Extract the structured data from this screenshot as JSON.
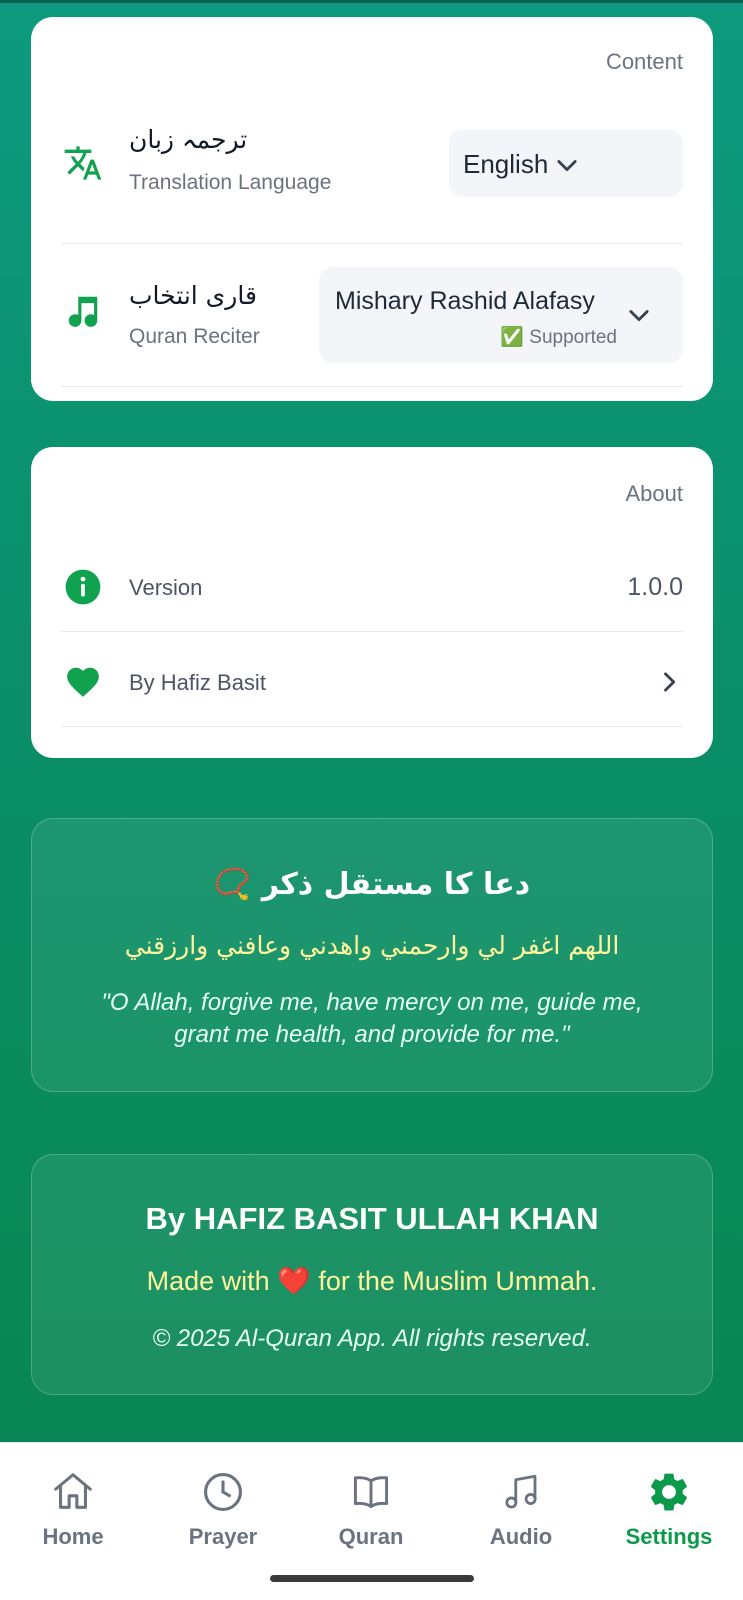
{
  "colors": {
    "accent": "#0b9a4a",
    "icon_green": "#11a24f",
    "heart": "#e11d2e",
    "dua_highlight": "#fff59d"
  },
  "content": {
    "title": "Content",
    "translation": {
      "urdu": "ترجمہ زبان",
      "label": "Translation Language",
      "value": "English",
      "icon": "translate-icon"
    },
    "reciter": {
      "urdu": "قاری انتخاب",
      "label": "Quran Reciter",
      "value": "Mishary Rashid Alafasy",
      "status": "✅ Supported",
      "icon": "music-note-icon"
    }
  },
  "about": {
    "title": "About",
    "version": {
      "label": "Version",
      "value": "1.0.0",
      "icon": "info-icon"
    },
    "author": {
      "label": "By Hafiz Basit",
      "icon": "heart-icon"
    }
  },
  "dua": {
    "title": "📿 دعا کا مستقل ذکر",
    "arabic": "اللهم اغفر لي وارحمني واهدني وعافني وارزقني",
    "english_line1": "\"O Allah, forgive me, have mercy on me, guide me,",
    "english_line2": "grant me health, and provide for me.\""
  },
  "credit": {
    "name": "By HAFIZ BASIT ULLAH KHAN",
    "made_prefix": "Made with",
    "made_heart": "❤️",
    "made_suffix": "for the Muslim Ummah.",
    "copyright": "© 2025 Al-Quran App. All rights reserved."
  },
  "nav": [
    {
      "label": "Home",
      "icon": "home-icon"
    },
    {
      "label": "Prayer",
      "icon": "clock-icon"
    },
    {
      "label": "Quran",
      "icon": "book-icon"
    },
    {
      "label": "Audio",
      "icon": "music-icon"
    },
    {
      "label": "Settings",
      "icon": "gear-icon",
      "active": true
    }
  ]
}
